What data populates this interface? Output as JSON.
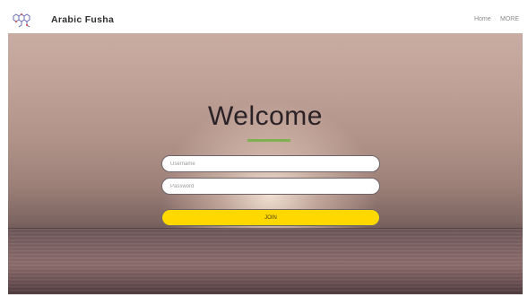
{
  "header": {
    "brand": "Arabic Fusha",
    "logo_icon": "molecule-logo-icon",
    "nav": [
      {
        "label": "Home"
      },
      {
        "label": "MORE"
      }
    ],
    "nav_separator": "·"
  },
  "hero": {
    "title": "Welcome",
    "accent_color": "#7fb152"
  },
  "form": {
    "username_placeholder": "Username",
    "password_placeholder": "Password",
    "join_label": "JOIN",
    "join_color": "#ffd800"
  }
}
